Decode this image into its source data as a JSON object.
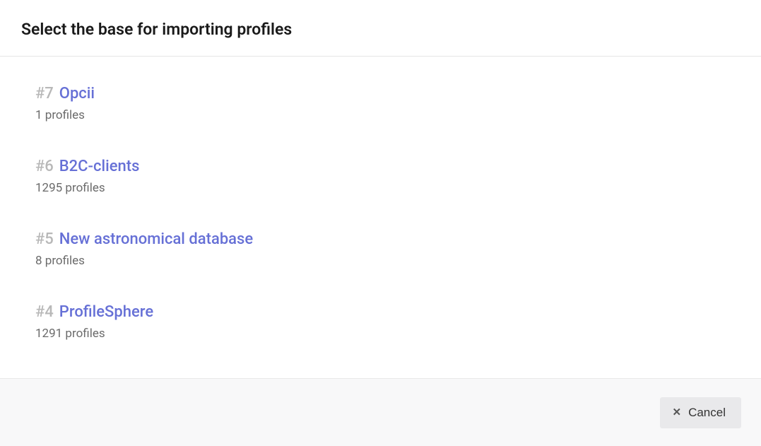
{
  "header": {
    "title": "Select the base for importing profiles"
  },
  "bases": [
    {
      "number": "#7",
      "name": "Opcii",
      "subtitle": "1 profiles"
    },
    {
      "number": "#6",
      "name": "B2C-clients",
      "subtitle": "1295 profiles"
    },
    {
      "number": "#5",
      "name": "New astronomical database",
      "subtitle": "8 profiles"
    },
    {
      "number": "#4",
      "name": "ProfileSphere",
      "subtitle": "1291 profiles"
    }
  ],
  "footer": {
    "cancel_label": "Cancel"
  }
}
